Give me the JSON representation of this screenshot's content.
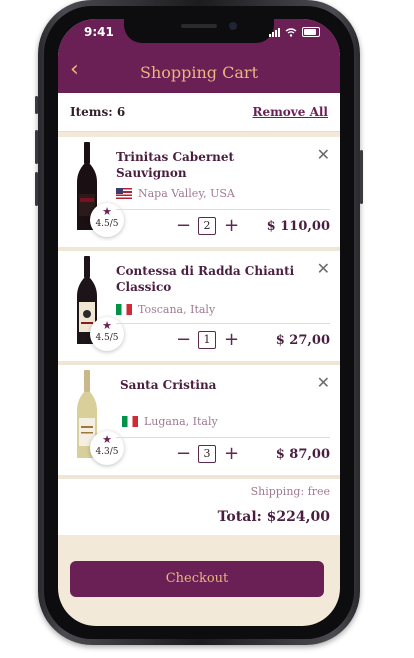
{
  "status": {
    "time": "9:41"
  },
  "header": {
    "back_icon": "chevron-left-icon",
    "title": "Shopping Cart"
  },
  "summary": {
    "items_label": "Items: 6",
    "remove_all": "Remove All"
  },
  "items": [
    {
      "name": "Trinitas Cabernet Sauvignon",
      "flag": "us",
      "origin": "Napa Valley, USA",
      "rating": "4.5/5",
      "quantity": "2",
      "price": "$ 110,00"
    },
    {
      "name": "Contessa di Radda Chianti Classico",
      "flag": "it",
      "origin": "Toscana, Italy",
      "rating": "4.5/5",
      "quantity": "1",
      "price": "$ 27,00"
    },
    {
      "name": "Santa Cristina",
      "flag": "it",
      "origin": "Lugana, Italy",
      "rating": "4.3/5",
      "quantity": "3",
      "price": "$ 87,00"
    }
  ],
  "totals": {
    "shipping": "Shipping: free",
    "total": "Total: $224,00"
  },
  "checkout": {
    "label": "Checkout"
  },
  "colors": {
    "accent": "#6a1f55",
    "gold": "#e9b77f",
    "cream": "#f3e9d8"
  }
}
